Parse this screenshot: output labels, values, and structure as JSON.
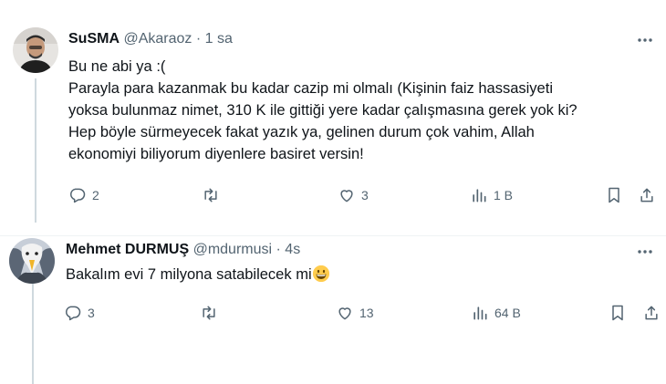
{
  "tweets": [
    {
      "name": "SuSMA",
      "handle": "@Akaraoz",
      "separator": "·",
      "time": "1 sa",
      "lines": [
        "Bu ne abi ya :(",
        "Parayla para kazanmak bu kadar cazip mi olmalı (Kişinin faiz hassasiyeti",
        "yoksa bulunmaz nimet, 310 K ile gittiği yere kadar çalışmasına gerek yok ki?",
        "Hep böyle sürmeyecek fakat yazık ya, gelinen durum çok vahim, Allah",
        "ekonomiyi biliyorum diyenlere basiret versin!"
      ],
      "replies": "2",
      "retweets": "",
      "likes": "3",
      "views": "1 B"
    },
    {
      "name": "Mehmet DURMUŞ",
      "handle": "@mdurmusi",
      "separator": "·",
      "time": "4s",
      "text": "Bakalım evi 7 milyona satabilecek mi",
      "emoji": "grinning-face-emoji",
      "replies": "3",
      "retweets": "",
      "likes": "13",
      "views": "64 B"
    }
  ],
  "icons": {
    "reply": "reply-icon",
    "retweet": "retweet-icon",
    "like": "heart-icon",
    "views": "views-chart-icon",
    "bookmark": "bookmark-icon",
    "share": "share-icon",
    "more": "more-dots-icon"
  },
  "colors": {
    "text": "#0f1419",
    "secondary": "#536471",
    "divider": "#eff3f4",
    "thread_line": "#cfd9de"
  }
}
